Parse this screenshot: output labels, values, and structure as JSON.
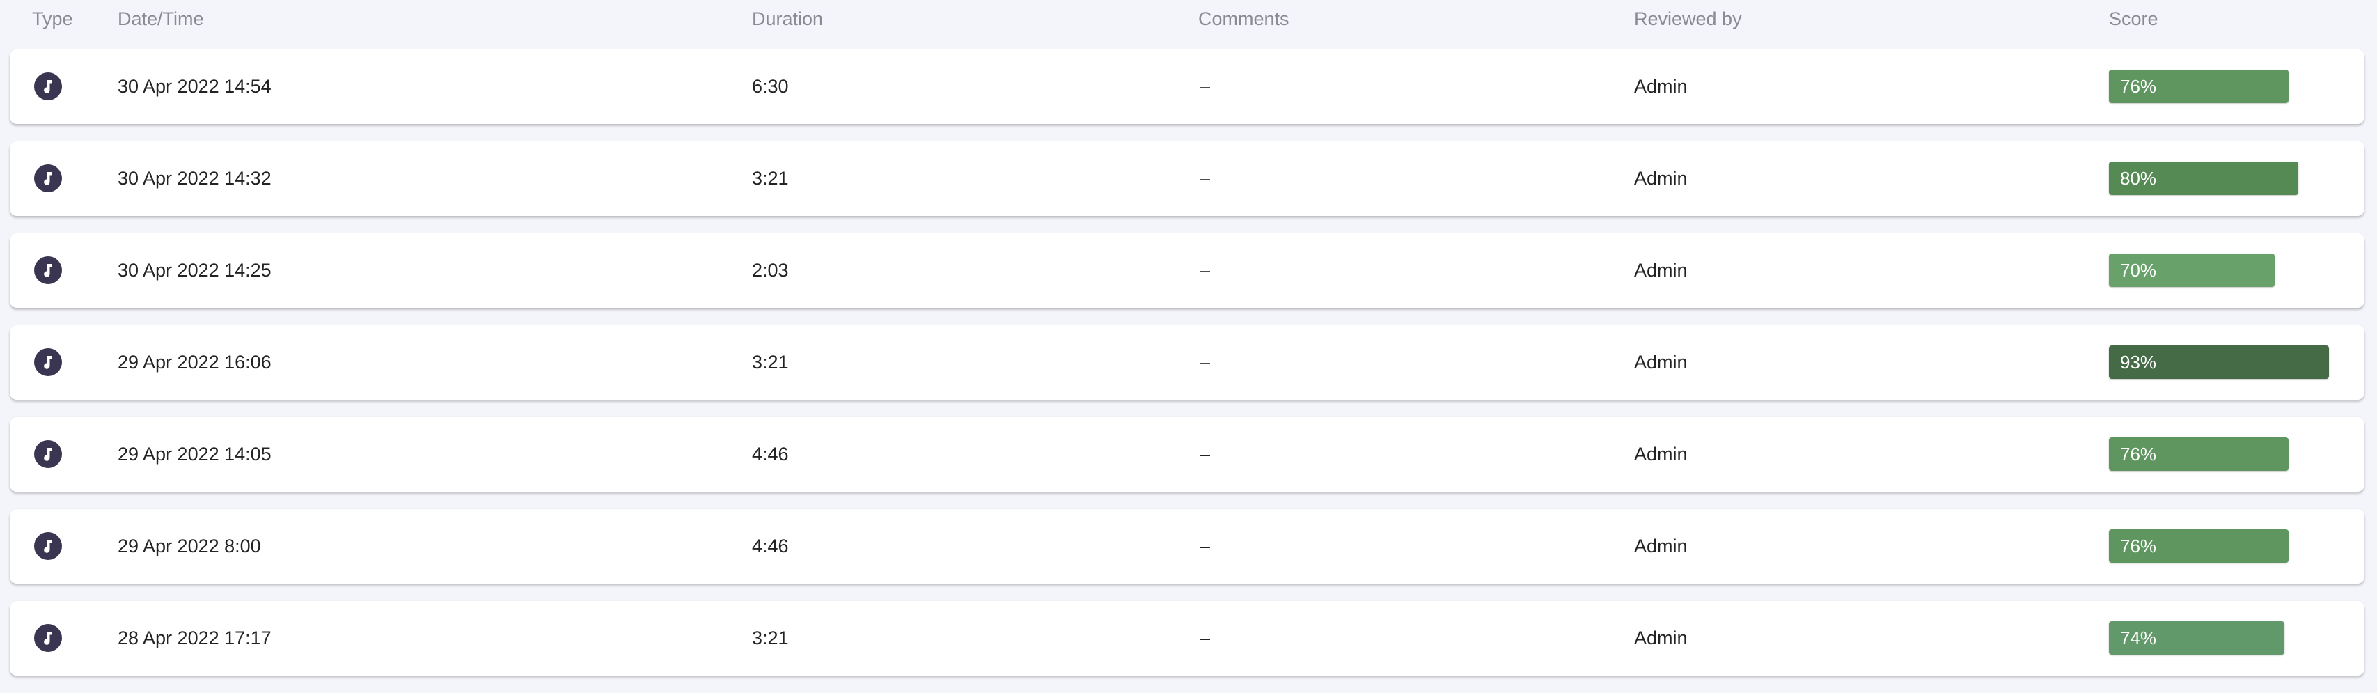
{
  "columns": {
    "type": "Type",
    "datetime": "Date/Time",
    "duration": "Duration",
    "comments": "Comments",
    "reviewed_by": "Reviewed by",
    "score": "Score"
  },
  "rows": [
    {
      "type_icon": "music-note-icon",
      "datetime": "30 Apr 2022 14:54",
      "duration": "6:30",
      "comments": "–",
      "reviewed_by": "Admin",
      "score_label": "76%",
      "score": 0.76,
      "score_color": "#5f9660"
    },
    {
      "type_icon": "music-note-icon",
      "datetime": "30 Apr 2022 14:32",
      "duration": "3:21",
      "comments": "–",
      "reviewed_by": "Admin",
      "score_label": "80%",
      "score": 0.8,
      "score_color": "#568a55"
    },
    {
      "type_icon": "music-note-icon",
      "datetime": "30 Apr 2022 14:25",
      "duration": "2:03",
      "comments": "–",
      "reviewed_by": "Admin",
      "score_label": "70%",
      "score": 0.7,
      "score_color": "#68a26a"
    },
    {
      "type_icon": "music-note-icon",
      "datetime": "29 Apr 2022 16:06",
      "duration": "3:21",
      "comments": "–",
      "reviewed_by": "Admin",
      "score_label": "93%",
      "score": 0.93,
      "score_color": "#446b46"
    },
    {
      "type_icon": "music-note-icon",
      "datetime": "29 Apr 2022 14:05",
      "duration": "4:46",
      "comments": "–",
      "reviewed_by": "Admin",
      "score_label": "76%",
      "score": 0.76,
      "score_color": "#5f9660"
    },
    {
      "type_icon": "music-note-icon",
      "datetime": "29 Apr 2022 8:00",
      "duration": "4:46",
      "comments": "–",
      "reviewed_by": "Admin",
      "score_label": "76%",
      "score": 0.76,
      "score_color": "#5f9660"
    },
    {
      "type_icon": "music-note-icon",
      "datetime": "28 Apr 2022 17:17",
      "duration": "3:21",
      "comments": "–",
      "reviewed_by": "Admin",
      "score_label": "74%",
      "score": 0.74,
      "score_color": "#62996a"
    }
  ],
  "colors": {
    "background": "#f4f5fb",
    "icon_badge": "#3a3550"
  }
}
